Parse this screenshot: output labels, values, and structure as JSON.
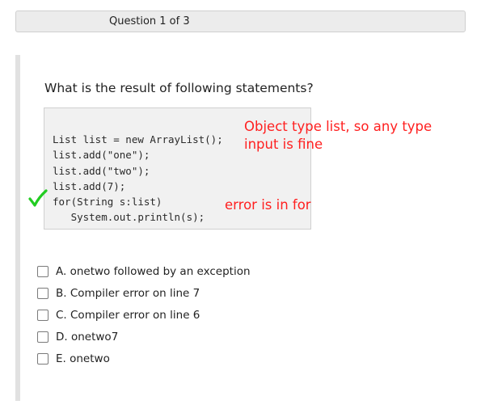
{
  "header": {
    "progress_label": "Question 1 of 3"
  },
  "question": {
    "prompt": "What is the result of following statements?",
    "code_lines": [
      "List list = new ArrayList();",
      "list.add(\"one\");",
      "list.add(\"two\");",
      "list.add(7);",
      "for(String s:list)",
      "   System.out.println(s);"
    ],
    "annotations": {
      "note_line_1": "Object type list, so any type",
      "note_line_2": "input is fine",
      "error_note": "error is in for"
    },
    "annotation_color": "#ff2020",
    "checkmark_color": "#22cc22",
    "options": [
      {
        "label": "A. onetwo followed by an exception",
        "checked": false
      },
      {
        "label": "B. Compiler error on line 7",
        "checked": false
      },
      {
        "label": "C. Compiler error on line 6",
        "checked": false
      },
      {
        "label": "D. onetwo7",
        "checked": false
      },
      {
        "label": "E. onetwo",
        "checked": false
      }
    ]
  }
}
